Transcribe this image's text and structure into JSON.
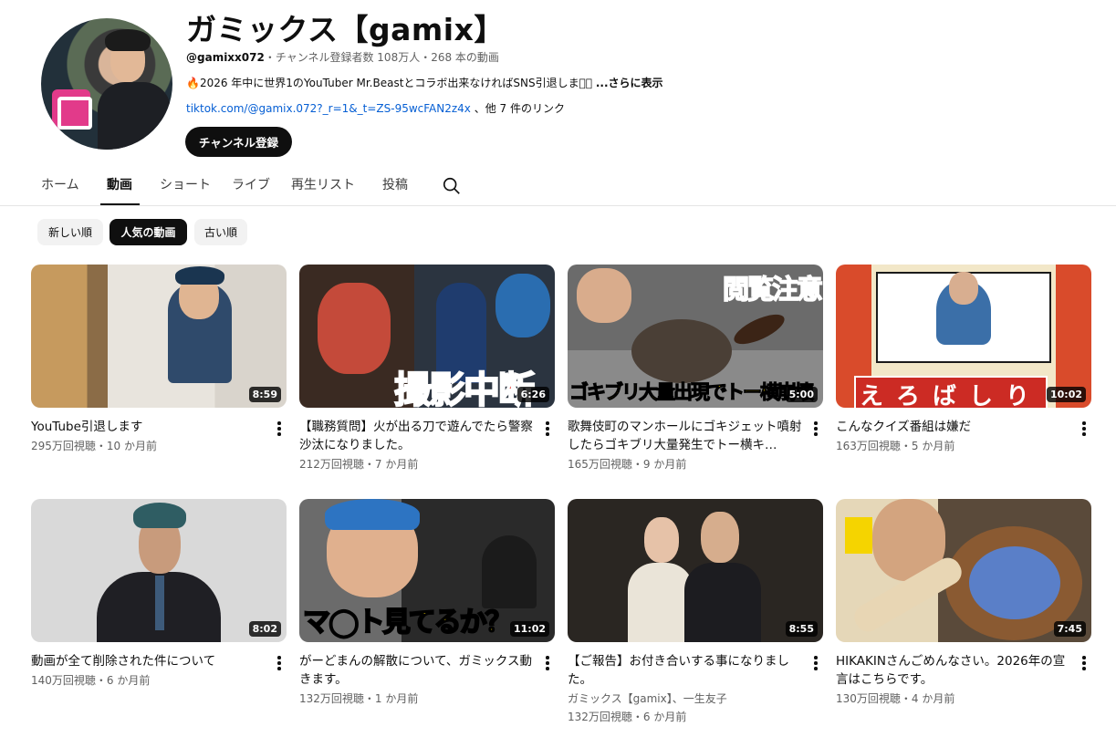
{
  "channel": {
    "title": "ガミックス【gamix】",
    "handle": "@gamixx072",
    "meta_rest": "・チャンネル登録者数 108万人・268 本の動画",
    "description": "🔥2026 年中に世界1のYouTuber Mr.Beastとコラボ出来なければSNS引退します🏻",
    "more_label": "...さらに表示",
    "link_url": "tiktok.com/@gamix.072?_r=1&_t=ZS-95wcFAN2z4x",
    "link_rest": "、他 7 件のリンク",
    "subscribe_label": "チャンネル登録"
  },
  "tabs": [
    {
      "label": "ホーム",
      "active": false
    },
    {
      "label": "動画",
      "active": true
    },
    {
      "label": "ショート",
      "active": false
    },
    {
      "label": "ライブ",
      "active": false
    },
    {
      "label": "再生リスト",
      "active": false
    },
    {
      "label": "投稿",
      "active": false
    }
  ],
  "chips": [
    {
      "label": "新しい順",
      "active": false
    },
    {
      "label": "人気の動画",
      "active": true
    },
    {
      "label": "古い順",
      "active": false
    }
  ],
  "videos": [
    {
      "title": "YouTube引退します",
      "channel": "",
      "stats": "295万回視聴・10 か月前",
      "duration": "8:59",
      "overlay": ""
    },
    {
      "title": "【職務質問】火が出る刀で遊んでたら警察沙汰になりました。",
      "channel": "",
      "stats": "212万回視聴・7 か月前",
      "duration": "6:26",
      "overlay": "撮影中断"
    },
    {
      "title": "歌舞伎町のマンホールにゴキジェット噴射したらゴキブリ大量発生でトー横キ…",
      "channel": "",
      "stats": "165万回視聴・9 か月前",
      "duration": "5:00",
      "overlay": "ゴキブリ大量出現でトー横崩壊",
      "overlay2": "閲覧注意"
    },
    {
      "title": "こんなクイズ番組は嫌だ",
      "channel": "",
      "stats": "163万回視聴・5 か月前",
      "duration": "10:02",
      "overlay": "えろばしり"
    },
    {
      "title": "動画が全て削除された件について",
      "channel": "",
      "stats": "140万回視聴・6 か月前",
      "duration": "8:02",
      "overlay": ""
    },
    {
      "title": "がーどまんの解散について、ガミックス動きます。",
      "channel": "",
      "stats": "132万回視聴・1 か月前",
      "duration": "11:02",
      "overlay": "マ◯ト見てるか？"
    },
    {
      "title": "【ご報告】お付き合いする事になりました。",
      "channel": "ガミックス【gamix】、一生友子",
      "stats": "132万回視聴・6 か月前",
      "duration": "8:55",
      "overlay": ""
    },
    {
      "title": "HIKAKINさんごめんなさい。2026年の宣言はこちらです。",
      "channel": "",
      "stats": "130万回視聴・4 か月前",
      "duration": "7:45",
      "overlay": ""
    }
  ],
  "icons": {
    "search": "search-icon",
    "more": "more-vert-icon"
  }
}
